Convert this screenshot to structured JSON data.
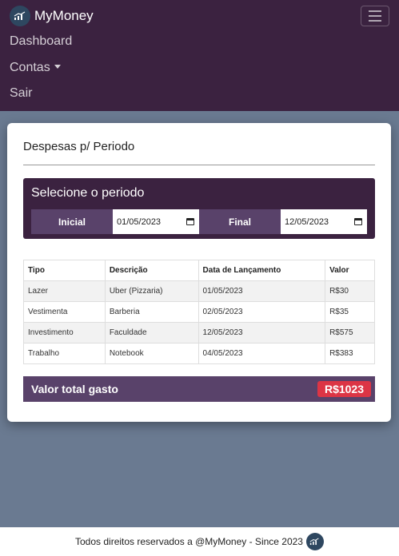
{
  "navbar": {
    "brand": "MyMoney",
    "links": [
      "Dashboard",
      "Contas",
      "Sair"
    ]
  },
  "card": {
    "title": "Despesas p/ Periodo",
    "period": {
      "title": "Selecione o periodo",
      "start_label": "Inicial",
      "start_value": "01/05/2023",
      "end_label": "Final",
      "end_value": "12/05/2023"
    },
    "table": {
      "headers": [
        "Tipo",
        "Descrição",
        "Data de Lançamento",
        "Valor"
      ],
      "rows": [
        [
          "Lazer",
          "Uber (Pizzaria)",
          "01/05/2023",
          "R$30"
        ],
        [
          "Vestimenta",
          "Barberia",
          "02/05/2023",
          "R$35"
        ],
        [
          "Investimento",
          "Faculdade",
          "12/05/2023",
          "R$575"
        ],
        [
          "Trabalho",
          "Notebook",
          "04/05/2023",
          "R$383"
        ]
      ]
    },
    "total": {
      "label": "Valor total gasto",
      "value": "R$1023"
    }
  },
  "footer": {
    "text": "Todos direitos reservados a @MyMoney - Since 2023"
  },
  "colors": {
    "navbar": "#3b2240",
    "accent": "#59426a",
    "badge": "#dc3545",
    "background": "#6a7a91"
  },
  "icons": [
    "chart-logo-icon",
    "hamburger-menu-icon",
    "caret-down-icon",
    "calendar-icon"
  ]
}
